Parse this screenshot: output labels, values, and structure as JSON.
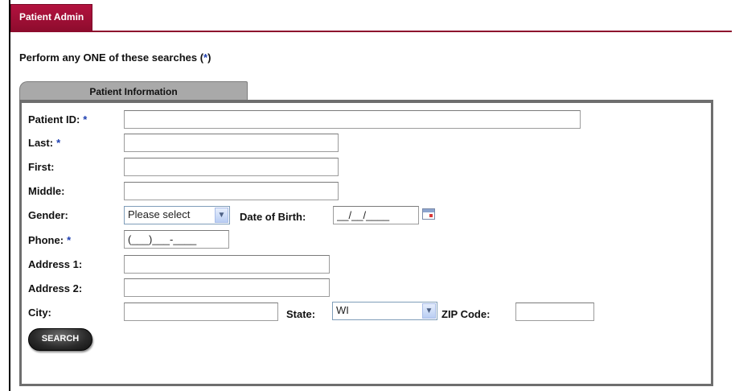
{
  "header": {
    "tab_label": "Patient Admin"
  },
  "instruction": {
    "text": "Perform any ONE of these searches (",
    "star": "*",
    "close": ")"
  },
  "panel": {
    "tab_label": "Patient Information"
  },
  "form": {
    "patient_id": {
      "label": "Patient ID:",
      "star": "*",
      "value": ""
    },
    "last": {
      "label": "Last:",
      "star": "*",
      "value": ""
    },
    "first": {
      "label": "First:",
      "value": ""
    },
    "middle": {
      "label": "Middle:",
      "value": ""
    },
    "gender": {
      "label": "Gender:",
      "selected": "Please select"
    },
    "dob": {
      "label": "Date of Birth:",
      "value": "__/__/____"
    },
    "phone": {
      "label": "Phone:",
      "star": "*",
      "value": "(___)___-____"
    },
    "address1": {
      "label": "Address 1:",
      "value": ""
    },
    "address2": {
      "label": "Address 2:",
      "value": ""
    },
    "city": {
      "label": "City:",
      "value": ""
    },
    "state": {
      "label": "State:",
      "selected": "WI"
    },
    "zip": {
      "label": "ZIP Code:",
      "value": ""
    }
  },
  "actions": {
    "search_label": "SEARCH"
  },
  "icons": {
    "calendar": "calendar-icon",
    "dropdown": "chevron-down-icon"
  },
  "colors": {
    "brand": "#8d0c2d",
    "required_star": "#1e3fb0"
  }
}
